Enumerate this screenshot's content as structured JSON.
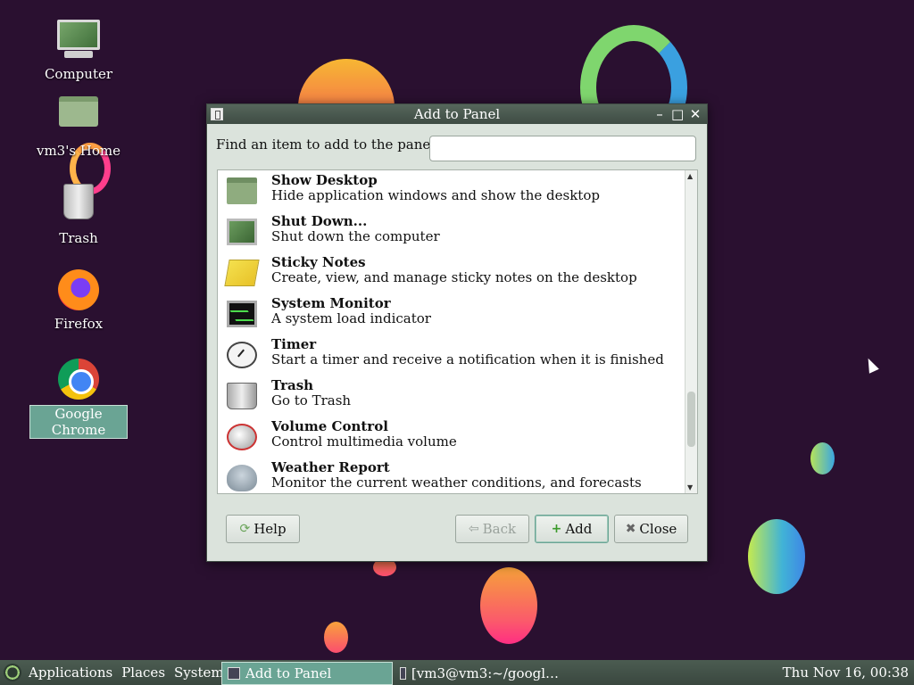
{
  "desktop": {
    "icons": [
      {
        "label": "Computer",
        "icon": "computer-icon"
      },
      {
        "label": "vm3's Home",
        "icon": "home-folder-icon"
      },
      {
        "label": "Trash",
        "icon": "trash-icon"
      },
      {
        "label": "Firefox",
        "icon": "firefox-icon"
      },
      {
        "label": "Google Chrome",
        "icon": "chrome-icon",
        "selected": true
      }
    ]
  },
  "dialog": {
    "title": "Add to Panel",
    "find_label": "Find an item to add to the panel:",
    "find_value": "",
    "items": [
      {
        "name": "Show Desktop",
        "desc": "Hide application windows and show the desktop",
        "icon": "show-desktop-icon"
      },
      {
        "name": "Shut Down...",
        "desc": "Shut down the computer",
        "icon": "shutdown-icon"
      },
      {
        "name": "Sticky Notes",
        "desc": "Create, view, and manage sticky notes on the desktop",
        "icon": "sticky-notes-icon"
      },
      {
        "name": "System Monitor",
        "desc": "A system load indicator",
        "icon": "system-monitor-icon"
      },
      {
        "name": "Timer",
        "desc": "Start a timer and receive a notification when it is finished",
        "icon": "timer-icon"
      },
      {
        "name": "Trash",
        "desc": "Go to Trash",
        "icon": "trash-icon"
      },
      {
        "name": "Volume Control",
        "desc": "Control multimedia volume",
        "icon": "volume-icon"
      },
      {
        "name": "Weather Report",
        "desc": "Monitor the current weather conditions, and forecasts",
        "icon": "weather-icon"
      }
    ],
    "buttons": {
      "help": "Help",
      "back": "Back",
      "add": "Add",
      "close": "Close"
    }
  },
  "taskbar": {
    "menus": [
      "Applications",
      "Places",
      "System"
    ],
    "tasks": [
      {
        "label": "Add to Panel",
        "active": true
      },
      {
        "label": "[vm3@vm3:~/googl…",
        "active": false
      }
    ],
    "clock": "Thu Nov 16, 00:38"
  }
}
